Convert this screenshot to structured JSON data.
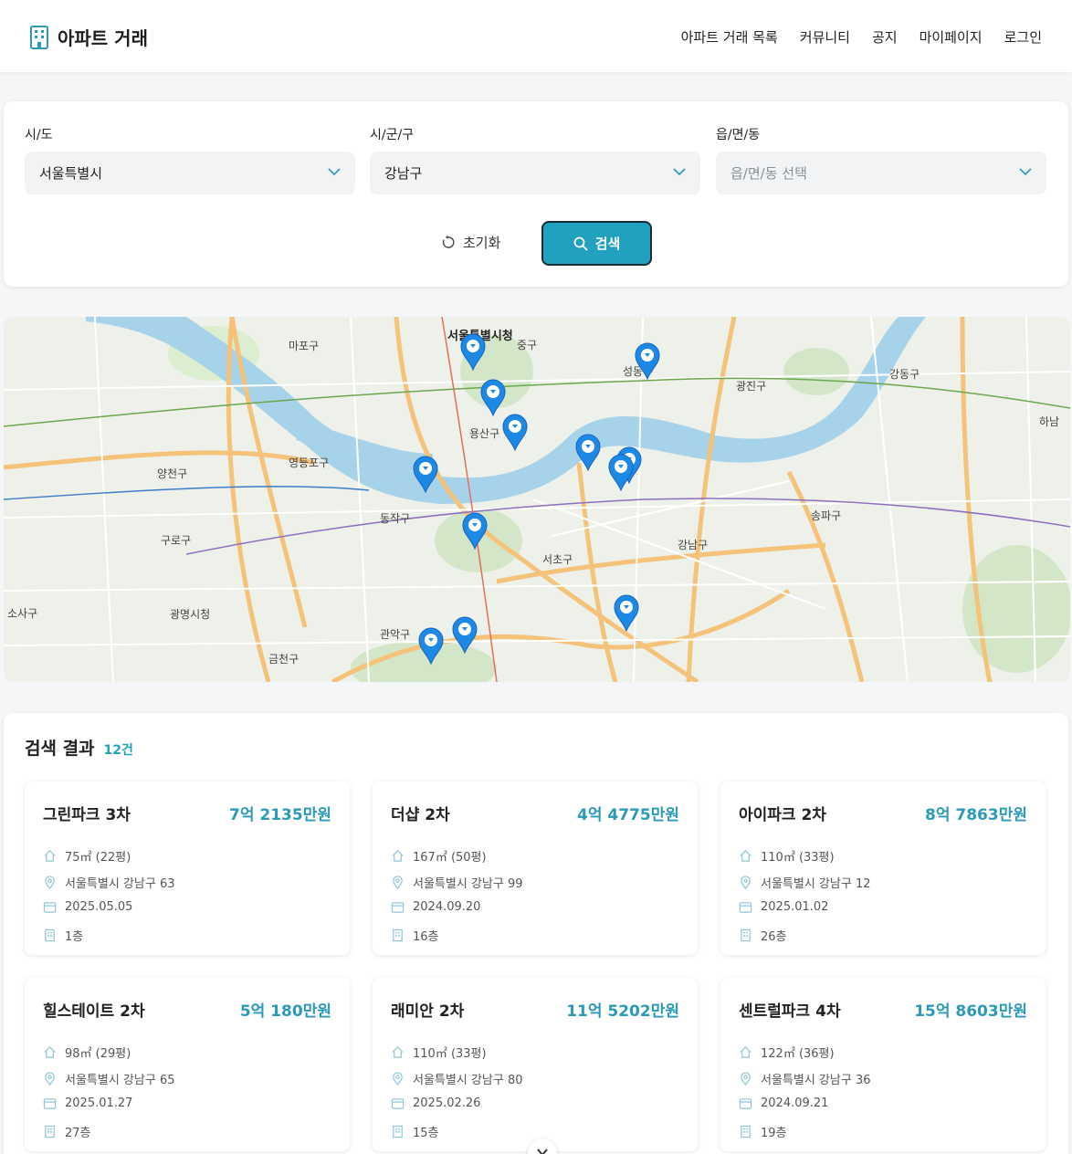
{
  "header": {
    "brand": "아파트 거래",
    "nav": [
      "아파트 거래 목록",
      "커뮤니티",
      "공지",
      "마이페이지",
      "로그인"
    ]
  },
  "filter": {
    "sido": {
      "label": "시/도",
      "value": "서울특별시"
    },
    "sigungu": {
      "label": "시/군/구",
      "value": "강남구"
    },
    "dong": {
      "label": "읍/면/동",
      "placeholder": "읍/면/동 선택"
    },
    "reset_label": "초기화",
    "search_label": "검색"
  },
  "map": {
    "labels": [
      "서울특별시청",
      "마포구",
      "용산구",
      "영등포구",
      "양천구",
      "구로구",
      "동작구",
      "서초구",
      "강남구",
      "송파구",
      "광진구",
      "강동구",
      "성동구",
      "중구",
      "광명시청",
      "금천구",
      "관악구",
      "소사구",
      "하남"
    ],
    "marker_count": 12,
    "accent": "#1e88e5"
  },
  "results": {
    "title": "검색 결과",
    "count": "12건",
    "items": [
      {
        "name": "그린파크 3차",
        "price": "7억 2135만원",
        "area": "75㎡ (22평)",
        "address": "서울특별시 강남구 63",
        "date": "2025.05.05",
        "floor": "1층"
      },
      {
        "name": "더샵 2차",
        "price": "4억 4775만원",
        "area": "167㎡ (50평)",
        "address": "서울특별시 강남구 99",
        "date": "2024.09.20",
        "floor": "16층"
      },
      {
        "name": "아이파크 2차",
        "price": "8억 7863만원",
        "area": "110㎡ (33평)",
        "address": "서울특별시 강남구 12",
        "date": "2025.01.02",
        "floor": "26층"
      },
      {
        "name": "힐스테이트 2차",
        "price": "5억 180만원",
        "area": "98㎡ (29평)",
        "address": "서울특별시 강남구 65",
        "date": "2025.01.27",
        "floor": "27층"
      },
      {
        "name": "래미안 2차",
        "price": "11억 5202만원",
        "area": "110㎡ (33평)",
        "address": "서울특별시 강남구 80",
        "date": "2025.02.26",
        "floor": "15층"
      },
      {
        "name": "센트럴파크 4차",
        "price": "15억 8603만원",
        "area": "122㎡ (36평)",
        "address": "서울특별시 강남구 36",
        "date": "2024.09.21",
        "floor": "19층"
      }
    ]
  },
  "colors": {
    "accent": "#22a0c0",
    "price": "#2a9ab8",
    "marker": "#1e88e5"
  }
}
